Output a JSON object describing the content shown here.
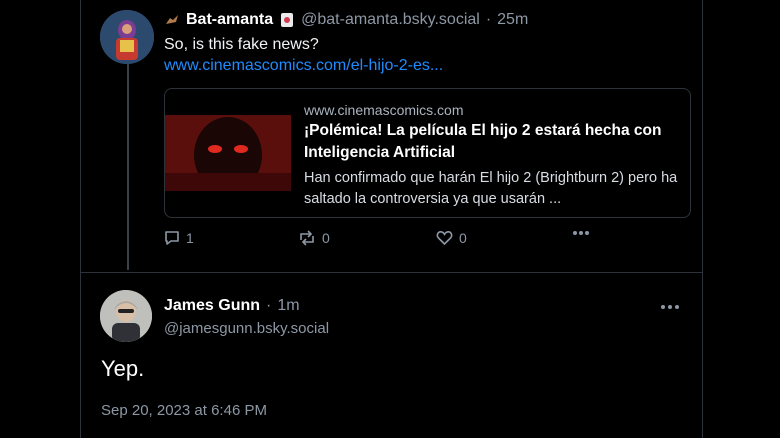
{
  "post1": {
    "display_name": "Bat-amanta",
    "handle": "@bat-amanta.bsky.social",
    "separator": "·",
    "time": "25m",
    "text": "So, is this fake news?",
    "link": "www.cinemascomics.com/el-hijo-2-es..."
  },
  "card": {
    "domain": "www.cinemascomics.com",
    "title": "¡Polémica! La película El hijo 2 estará hecha con Inteligencia Artificial",
    "description": "Han confirmado que harán El hijo 2 (Brightburn 2) pero ha saltado la controversia ya que usarán ..."
  },
  "actions": {
    "reply_count": "1",
    "repost_count": "0",
    "like_count": "0"
  },
  "post2": {
    "display_name": "James Gunn",
    "separator": "·",
    "time": "1m",
    "handle": "@jamesgunn.bsky.social",
    "text": "Yep.",
    "timestamp": "Sep 20, 2023 at 6:46 PM"
  },
  "colors": {
    "link": "#208bfe",
    "muted": "#8d98a5",
    "border": "#2e3339"
  }
}
